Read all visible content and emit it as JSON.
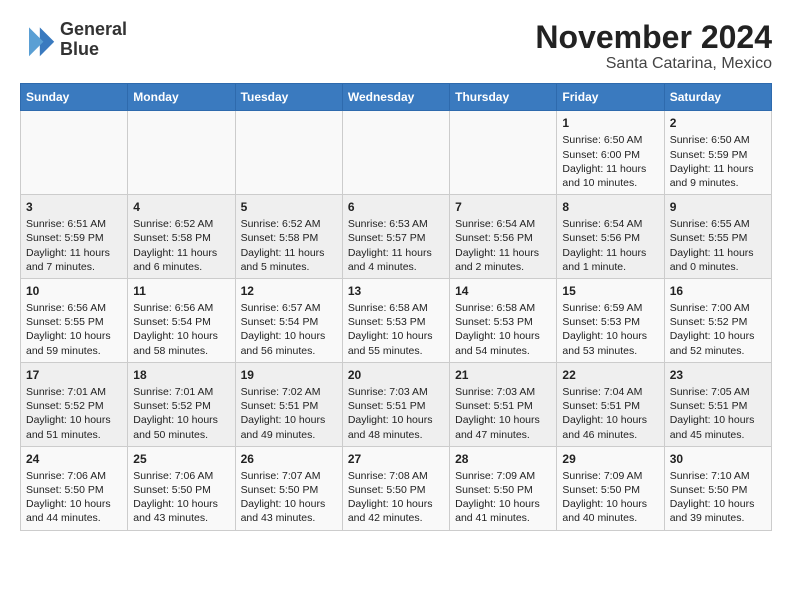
{
  "header": {
    "logo_line1": "General",
    "logo_line2": "Blue",
    "title": "November 2024",
    "subtitle": "Santa Catarina, Mexico"
  },
  "days_of_week": [
    "Sunday",
    "Monday",
    "Tuesday",
    "Wednesday",
    "Thursday",
    "Friday",
    "Saturday"
  ],
  "weeks": [
    [
      {
        "day": "",
        "info": ""
      },
      {
        "day": "",
        "info": ""
      },
      {
        "day": "",
        "info": ""
      },
      {
        "day": "",
        "info": ""
      },
      {
        "day": "",
        "info": ""
      },
      {
        "day": "1",
        "info": "Sunrise: 6:50 AM\nSunset: 6:00 PM\nDaylight: 11 hours and 10 minutes."
      },
      {
        "day": "2",
        "info": "Sunrise: 6:50 AM\nSunset: 5:59 PM\nDaylight: 11 hours and 9 minutes."
      }
    ],
    [
      {
        "day": "3",
        "info": "Sunrise: 6:51 AM\nSunset: 5:59 PM\nDaylight: 11 hours and 7 minutes."
      },
      {
        "day": "4",
        "info": "Sunrise: 6:52 AM\nSunset: 5:58 PM\nDaylight: 11 hours and 6 minutes."
      },
      {
        "day": "5",
        "info": "Sunrise: 6:52 AM\nSunset: 5:58 PM\nDaylight: 11 hours and 5 minutes."
      },
      {
        "day": "6",
        "info": "Sunrise: 6:53 AM\nSunset: 5:57 PM\nDaylight: 11 hours and 4 minutes."
      },
      {
        "day": "7",
        "info": "Sunrise: 6:54 AM\nSunset: 5:56 PM\nDaylight: 11 hours and 2 minutes."
      },
      {
        "day": "8",
        "info": "Sunrise: 6:54 AM\nSunset: 5:56 PM\nDaylight: 11 hours and 1 minute."
      },
      {
        "day": "9",
        "info": "Sunrise: 6:55 AM\nSunset: 5:55 PM\nDaylight: 11 hours and 0 minutes."
      }
    ],
    [
      {
        "day": "10",
        "info": "Sunrise: 6:56 AM\nSunset: 5:55 PM\nDaylight: 10 hours and 59 minutes."
      },
      {
        "day": "11",
        "info": "Sunrise: 6:56 AM\nSunset: 5:54 PM\nDaylight: 10 hours and 58 minutes."
      },
      {
        "day": "12",
        "info": "Sunrise: 6:57 AM\nSunset: 5:54 PM\nDaylight: 10 hours and 56 minutes."
      },
      {
        "day": "13",
        "info": "Sunrise: 6:58 AM\nSunset: 5:53 PM\nDaylight: 10 hours and 55 minutes."
      },
      {
        "day": "14",
        "info": "Sunrise: 6:58 AM\nSunset: 5:53 PM\nDaylight: 10 hours and 54 minutes."
      },
      {
        "day": "15",
        "info": "Sunrise: 6:59 AM\nSunset: 5:53 PM\nDaylight: 10 hours and 53 minutes."
      },
      {
        "day": "16",
        "info": "Sunrise: 7:00 AM\nSunset: 5:52 PM\nDaylight: 10 hours and 52 minutes."
      }
    ],
    [
      {
        "day": "17",
        "info": "Sunrise: 7:01 AM\nSunset: 5:52 PM\nDaylight: 10 hours and 51 minutes."
      },
      {
        "day": "18",
        "info": "Sunrise: 7:01 AM\nSunset: 5:52 PM\nDaylight: 10 hours and 50 minutes."
      },
      {
        "day": "19",
        "info": "Sunrise: 7:02 AM\nSunset: 5:51 PM\nDaylight: 10 hours and 49 minutes."
      },
      {
        "day": "20",
        "info": "Sunrise: 7:03 AM\nSunset: 5:51 PM\nDaylight: 10 hours and 48 minutes."
      },
      {
        "day": "21",
        "info": "Sunrise: 7:03 AM\nSunset: 5:51 PM\nDaylight: 10 hours and 47 minutes."
      },
      {
        "day": "22",
        "info": "Sunrise: 7:04 AM\nSunset: 5:51 PM\nDaylight: 10 hours and 46 minutes."
      },
      {
        "day": "23",
        "info": "Sunrise: 7:05 AM\nSunset: 5:51 PM\nDaylight: 10 hours and 45 minutes."
      }
    ],
    [
      {
        "day": "24",
        "info": "Sunrise: 7:06 AM\nSunset: 5:50 PM\nDaylight: 10 hours and 44 minutes."
      },
      {
        "day": "25",
        "info": "Sunrise: 7:06 AM\nSunset: 5:50 PM\nDaylight: 10 hours and 43 minutes."
      },
      {
        "day": "26",
        "info": "Sunrise: 7:07 AM\nSunset: 5:50 PM\nDaylight: 10 hours and 43 minutes."
      },
      {
        "day": "27",
        "info": "Sunrise: 7:08 AM\nSunset: 5:50 PM\nDaylight: 10 hours and 42 minutes."
      },
      {
        "day": "28",
        "info": "Sunrise: 7:09 AM\nSunset: 5:50 PM\nDaylight: 10 hours and 41 minutes."
      },
      {
        "day": "29",
        "info": "Sunrise: 7:09 AM\nSunset: 5:50 PM\nDaylight: 10 hours and 40 minutes."
      },
      {
        "day": "30",
        "info": "Sunrise: 7:10 AM\nSunset: 5:50 PM\nDaylight: 10 hours and 39 minutes."
      }
    ]
  ]
}
